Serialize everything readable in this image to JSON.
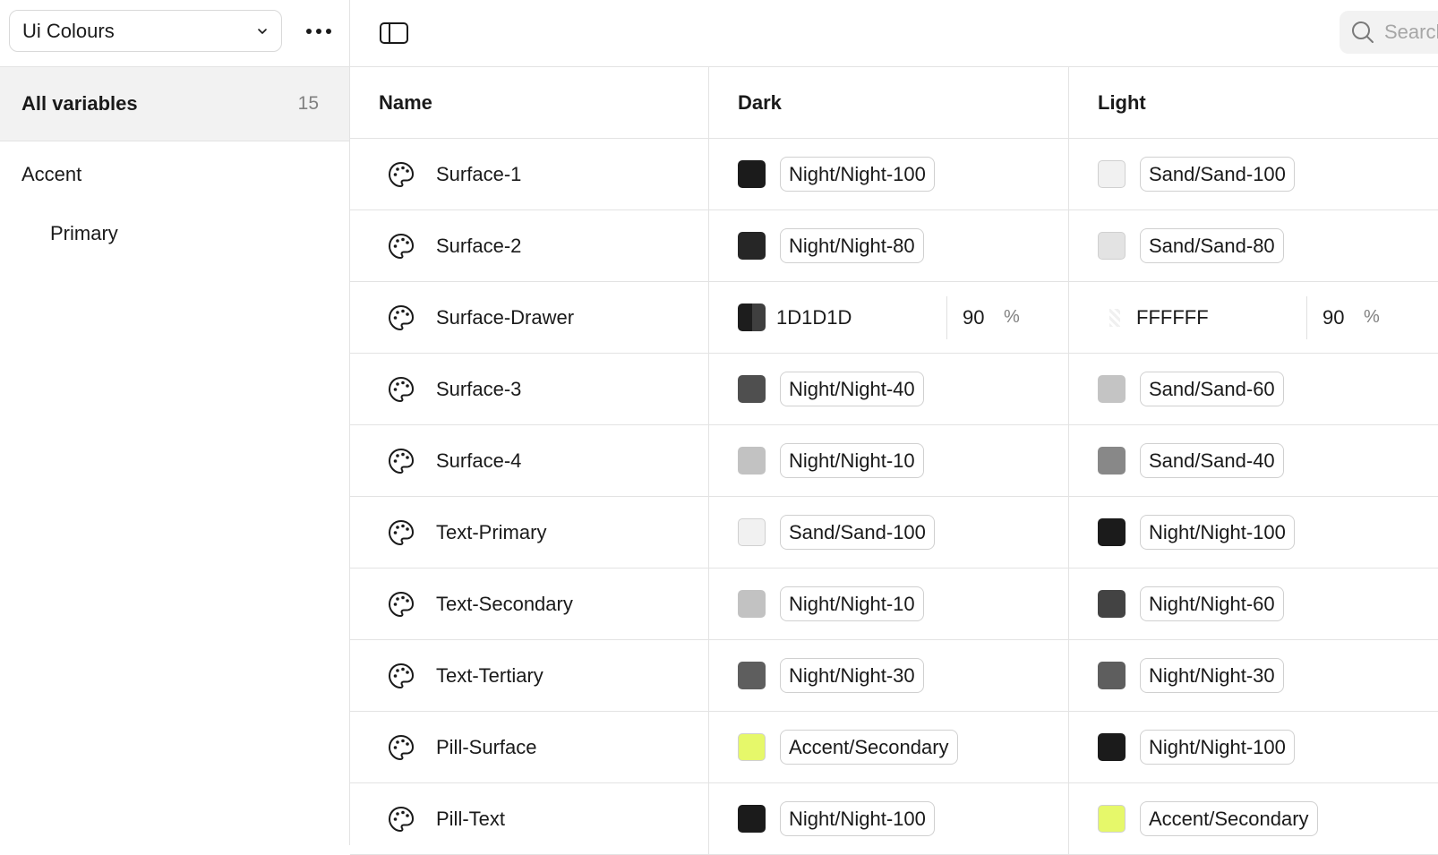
{
  "sidebar": {
    "collection": "Ui Colours",
    "all_variables": {
      "label": "All variables",
      "count": "15"
    },
    "groups": [
      "Accent",
      "Primary"
    ]
  },
  "search": {
    "placeholder": "Search"
  },
  "table": {
    "headers": {
      "name": "Name",
      "dark": "Dark",
      "light": "Light"
    },
    "rows": [
      {
        "name": "Surface-1",
        "dark": {
          "swatch": "#1b1b1b",
          "label": "Night/Night-100"
        },
        "light": {
          "swatch": "#f1f1f1",
          "label": "Sand/Sand-100"
        }
      },
      {
        "name": "Surface-2",
        "dark": {
          "swatch": "#262626",
          "label": "Night/Night-80"
        },
        "light": {
          "swatch": "#e3e3e3",
          "label": "Sand/Sand-80"
        }
      },
      {
        "name": "Surface-Drawer",
        "dark": {
          "swatch": "#1d1d1d",
          "hex": "1D1D1D",
          "alpha": "90",
          "unit": "%"
        },
        "light": {
          "swatch": "#ffffff",
          "hex": "FFFFFF",
          "alpha": "90",
          "unit": "%"
        }
      },
      {
        "name": "Surface-3",
        "dark": {
          "swatch": "#4f4f4f",
          "label": "Night/Night-40"
        },
        "light": {
          "swatch": "#c4c4c4",
          "label": "Sand/Sand-60"
        }
      },
      {
        "name": "Surface-4",
        "dark": {
          "swatch": "#c2c2c2",
          "label": "Night/Night-10"
        },
        "light": {
          "swatch": "#888888",
          "label": "Sand/Sand-40"
        }
      },
      {
        "name": "Text-Primary",
        "dark": {
          "swatch": "#f1f1f1",
          "label": "Sand/Sand-100"
        },
        "light": {
          "swatch": "#1b1b1b",
          "label": "Night/Night-100"
        }
      },
      {
        "name": "Text-Secondary",
        "dark": {
          "swatch": "#c2c2c2",
          "label": "Night/Night-10"
        },
        "light": {
          "swatch": "#434343",
          "label": "Night/Night-60"
        }
      },
      {
        "name": "Text-Tertiary",
        "dark": {
          "swatch": "#5e5e5e",
          "label": "Night/Night-30"
        },
        "light": {
          "swatch": "#5e5e5e",
          "label": "Night/Night-30"
        }
      },
      {
        "name": "Pill-Surface",
        "dark": {
          "swatch": "#e6f86a",
          "label": "Accent/Secondary"
        },
        "light": {
          "swatch": "#1b1b1b",
          "label": "Night/Night-100"
        }
      },
      {
        "name": "Pill-Text",
        "dark": {
          "swatch": "#1b1b1b",
          "label": "Night/Night-100"
        },
        "light": {
          "swatch": "#e6f86a",
          "label": "Accent/Secondary"
        }
      }
    ]
  }
}
